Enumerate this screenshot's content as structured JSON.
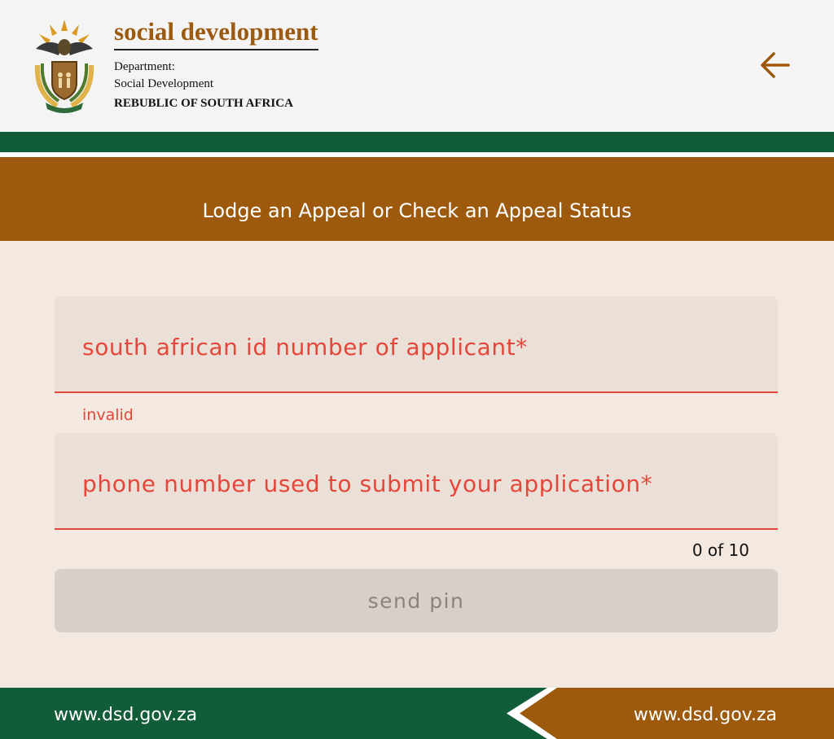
{
  "header": {
    "brand_title": "social development",
    "department_label": "Department:",
    "department_name": "Social Development",
    "country": "REBUBLIC OF SOUTH AFRICA",
    "back_icon": "arrow-left-icon",
    "crest_icon": "coat-of-arms-icon"
  },
  "page": {
    "title": "Lodge an Appeal or Check an Appeal Status"
  },
  "form": {
    "id_field": {
      "placeholder": "south african id number of applicant*",
      "error": "invalid"
    },
    "phone_field": {
      "placeholder": "phone number used to submit your application*",
      "counter": "0 of 10"
    },
    "submit_label": "send pin"
  },
  "footer": {
    "left_link": "www.dsd.gov.za",
    "right_link": "www.dsd.gov.za"
  },
  "colors": {
    "brand_brown": "#9d5a0d",
    "brand_green": "#115c39",
    "error_red": "#e4473a",
    "background": "#f3e9e0"
  }
}
